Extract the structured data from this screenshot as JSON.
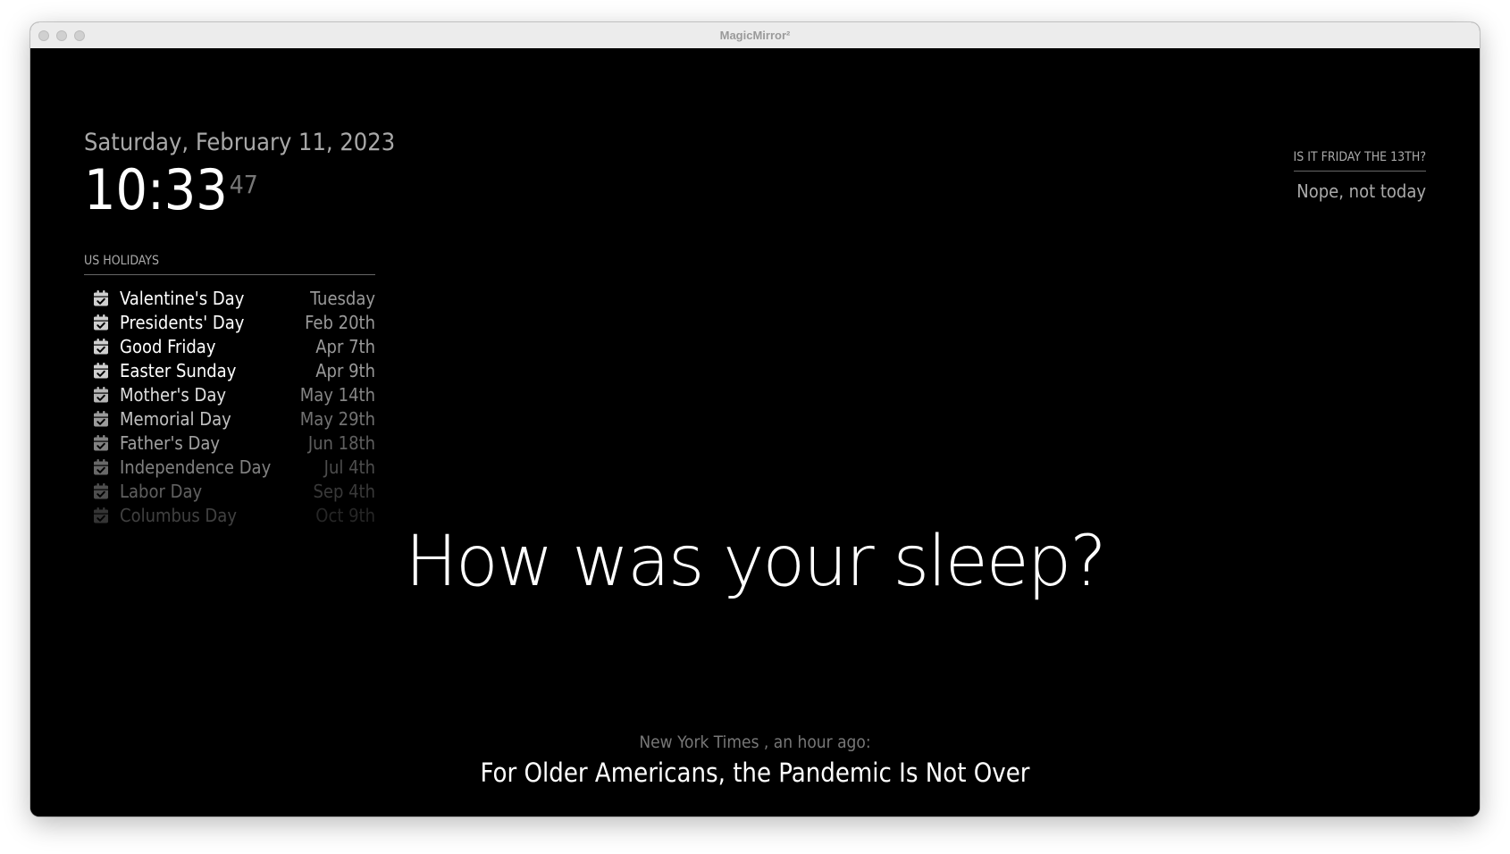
{
  "window": {
    "title": "MagicMirror²"
  },
  "clock": {
    "date": "Saturday, February 11, 2023",
    "time": "10:33",
    "seconds": "47"
  },
  "calendar": {
    "header": "US Holidays",
    "icon": "calendar-check-icon",
    "events": [
      {
        "title": "Valentine's Day",
        "time": "Tuesday",
        "opacity": 1.0
      },
      {
        "title": "Presidents' Day",
        "time": "Feb 20th",
        "opacity": 1.0
      },
      {
        "title": "Good Friday",
        "time": "Apr 7th",
        "opacity": 1.0
      },
      {
        "title": "Easter Sunday",
        "time": "Apr 9th",
        "opacity": 1.0
      },
      {
        "title": "Mother's Day",
        "time": "May 14th",
        "opacity": 0.875
      },
      {
        "title": "Memorial Day",
        "time": "May 29th",
        "opacity": 0.75
      },
      {
        "title": "Father's Day",
        "time": "Jun 18th",
        "opacity": 0.625
      },
      {
        "title": "Independence Day",
        "time": "Jul 4th",
        "opacity": 0.5
      },
      {
        "title": "Labor Day",
        "time": "Sep 4th",
        "opacity": 0.375
      },
      {
        "title": "Columbus Day",
        "time": "Oct 9th",
        "opacity": 0.25
      }
    ]
  },
  "friday13": {
    "header": "Is it Friday the 13th?",
    "answer": "Nope, not today"
  },
  "compliment": {
    "text": "How was your sleep?"
  },
  "newsfeed": {
    "source": "New York Times , an hour ago:",
    "headline": "For Older Americans, the Pandemic Is Not Over"
  },
  "colors": {
    "background": "#000000",
    "bright": "#ffffff",
    "normal": "#aaaaaa",
    "dimmed": "#777777"
  }
}
